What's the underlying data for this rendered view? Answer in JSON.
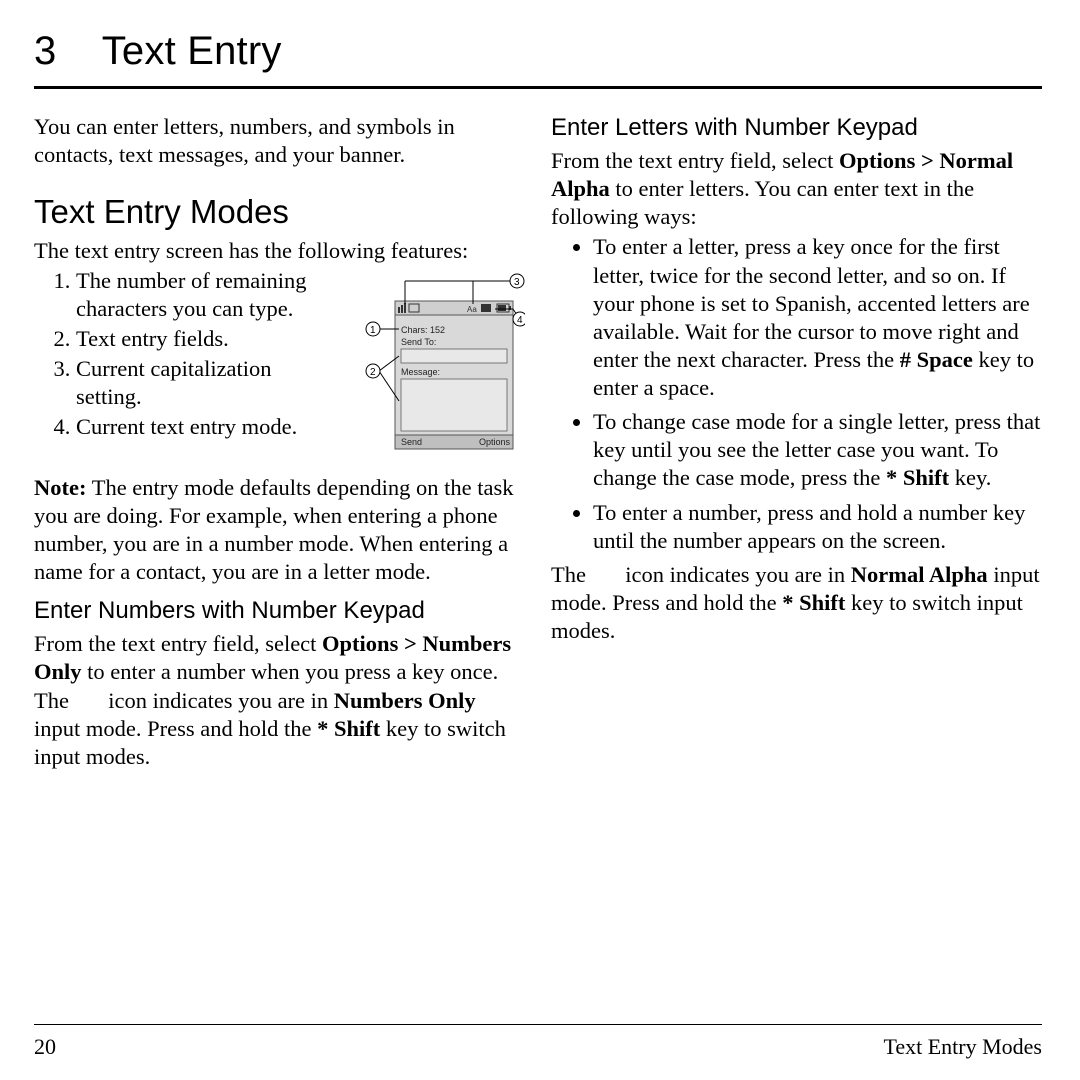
{
  "chapter": {
    "number": "3",
    "title": "Text Entry"
  },
  "col1": {
    "intro": "You can enter letters, numbers, and symbols in contacts, text messages, and your banner.",
    "modes_heading": "Text Entry Modes",
    "modes_intro": "The text entry screen has the following features:",
    "features": [
      "The number of remaining characters you can type.",
      "Text entry fields.",
      "Current capitalization setting.",
      "Current text entry mode."
    ],
    "note_label": "Note:",
    "note_body": " The entry mode defaults depending on the task you are doing. For example, when entering a phone number, you are in a number mode. When entering a name for a contact, you are in a letter mode.",
    "numbers_heading": "Enter Numbers with Number Keypad",
    "numbers_p1_a": "From the text entry field, select ",
    "numbers_p1_b": "Options > Numbers Only",
    "numbers_p1_c": " to enter a number when you press a key once.",
    "numbers_p2_a": "The ",
    "numbers_p2_b": " icon indicates you are in ",
    "numbers_p2_c": "Numbers Only",
    "numbers_p2_d": " input mode. Press and hold the ",
    "numbers_p2_e": "* Shift",
    "numbers_p2_f": " key to switch input modes."
  },
  "col2": {
    "letters_heading": "Enter Letters with Number Keypad",
    "letters_p1_a": "From the text entry field, select ",
    "letters_p1_b": "Options > Normal Alpha",
    "letters_p1_c": " to enter letters. You can enter text in the following ways:",
    "bullets": {
      "b1_a": "To enter a letter, press a key once for the first letter, twice for the second letter, and so on. If your phone is set to Spanish, accented letters are available. Wait for the cursor to move right and enter the next character. Press the ",
      "b1_b": "# Space",
      "b1_c": " key to enter a space.",
      "b2_a": "To change case mode for a single letter, press that key until you see the letter case you want. To change the case mode, press the ",
      "b2_b": "* Shift",
      "b2_c": " key.",
      "b3": "To enter a number, press and hold a number key until the number appears on the screen."
    },
    "letters_p2_a": "The ",
    "letters_p2_b": " icon indicates you are in ",
    "letters_p2_c": "Normal Alpha",
    "letters_p2_d": " input mode. Press and hold the ",
    "letters_p2_e": "* Shift",
    "letters_p2_f": " key to switch input modes."
  },
  "diagram": {
    "chars_label": "Chars: 152",
    "sendto_label": "Send To:",
    "message_label": "Message:",
    "send_btn": "Send",
    "options_btn": "Options",
    "callouts": {
      "c1": "1",
      "c2": "2",
      "c3": "3",
      "c4": "4"
    }
  },
  "footer": {
    "page": "20",
    "section": "Text Entry Modes"
  }
}
